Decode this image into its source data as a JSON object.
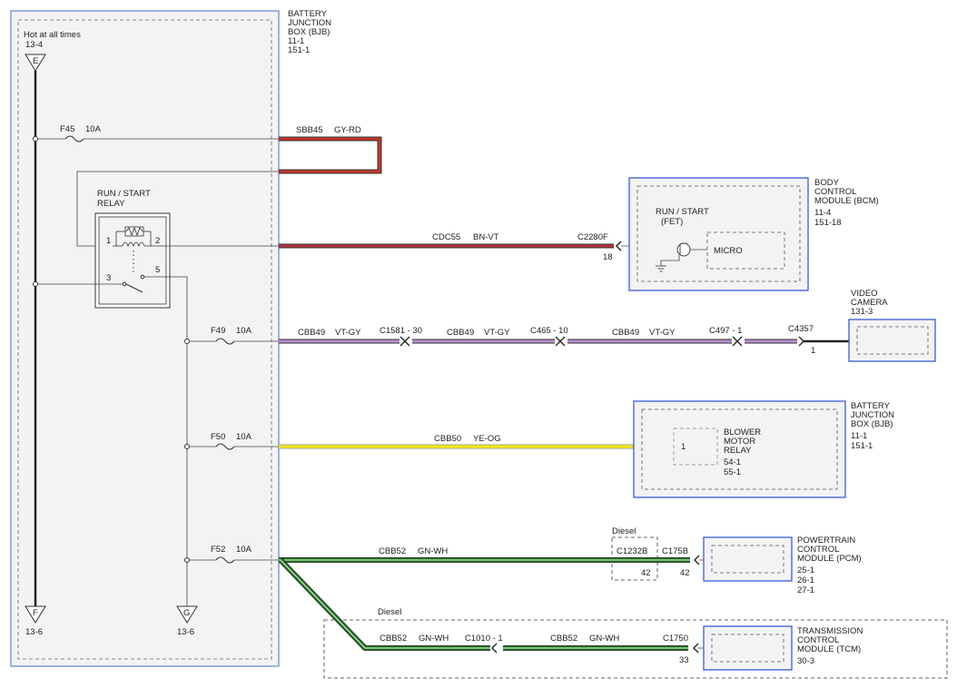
{
  "bjb": {
    "title_lines": [
      "BATTERY",
      "JUNCTION",
      "BOX (BJB)",
      "11-1",
      "151-1"
    ],
    "hot_label": "Hot at all times",
    "hot_ref": "13-4",
    "bus_top_letter": "E",
    "bus_f_letter": "F",
    "bus_f_ref": "13-6",
    "bus_g_letter": "G",
    "bus_g_ref": "13-6"
  },
  "relay": {
    "title_lines": [
      "RUN / START",
      "RELAY"
    ],
    "pin1": "1",
    "pin2": "2",
    "pin3": "3",
    "pin5": "5"
  },
  "fuses": {
    "f45": {
      "name": "F45",
      "rating": "10A"
    },
    "f49": {
      "name": "F49",
      "rating": "10A"
    },
    "f50": {
      "name": "F50",
      "rating": "10A"
    },
    "f52": {
      "name": "F52",
      "rating": "10A"
    }
  },
  "wires": {
    "sbb45": {
      "circuit": "SBB45",
      "color": "GY-RD"
    },
    "cdc55": {
      "circuit": "CDC55",
      "color": "BN-VT"
    },
    "cbb49_1": {
      "circuit": "CBB49",
      "color": "VT-GY"
    },
    "cbb49_2": {
      "circuit": "CBB49",
      "color": "VT-GY"
    },
    "cbb49_3": {
      "circuit": "CBB49",
      "color": "VT-GY"
    },
    "cbb50": {
      "circuit": "CBB50",
      "color": "YE-OG"
    },
    "cbb52_pcm": {
      "circuit": "CBB52",
      "color": "GN-WH"
    },
    "cbb52_a": {
      "circuit": "CBB52",
      "color": "GN-WH"
    },
    "cbb52_b": {
      "circuit": "CBB52",
      "color": "GN-WH"
    }
  },
  "connectors": {
    "c2280f": {
      "name": "C2280F",
      "pin": "18"
    },
    "c1581": {
      "name": "C1581 - 30"
    },
    "c465": {
      "name": "C465 - 10"
    },
    "c497": {
      "name": "C497 - 1"
    },
    "c4357": {
      "name": "C4357",
      "pin": "1"
    },
    "c1232b": {
      "name": "C1232B",
      "pin": "42"
    },
    "c175b": {
      "name": "C175B",
      "pin": "42"
    },
    "c1010": {
      "name": "C1010 - 1"
    },
    "c1750": {
      "name": "C1750",
      "pin": "33"
    },
    "blower_pin": "1"
  },
  "bcm": {
    "title_lines": [
      "BODY",
      "CONTROL",
      "MODULE (BCM)",
      "11-4",
      "151-18"
    ],
    "fet_lines": [
      "RUN / START",
      "(FET)"
    ],
    "micro": "MICRO"
  },
  "camera": {
    "title_lines": [
      "VIDEO",
      "CAMERA",
      "131-3"
    ]
  },
  "bjb2": {
    "title_lines": [
      "BATTERY",
      "JUNCTION",
      "BOX (BJB)",
      "11-1",
      "151-1"
    ],
    "relay_lines": [
      "BLOWER",
      "MOTOR",
      "RELAY",
      "54-1",
      "55-1"
    ]
  },
  "pcm": {
    "title_lines": [
      "POWERTRAIN",
      "CONTROL",
      "MODULE (PCM)",
      "25-1",
      "26-1",
      "27-1"
    ]
  },
  "tcm": {
    "title_lines": [
      "TRANSMISSION",
      "CONTROL",
      "MODULE (TCM)",
      "30-3"
    ]
  },
  "diesel": {
    "label_pcm": "Diesel",
    "label_tcm": "Diesel"
  },
  "colors": {
    "gy_rd": "#c0392b",
    "bn_vt": "#b03040",
    "vt_gy": "#b98fd0",
    "ye_og": "#f0e020",
    "gn_wh": "#1a7a1a",
    "module_border": "#3b5bdb",
    "module_fill": "#f3f3f3"
  }
}
